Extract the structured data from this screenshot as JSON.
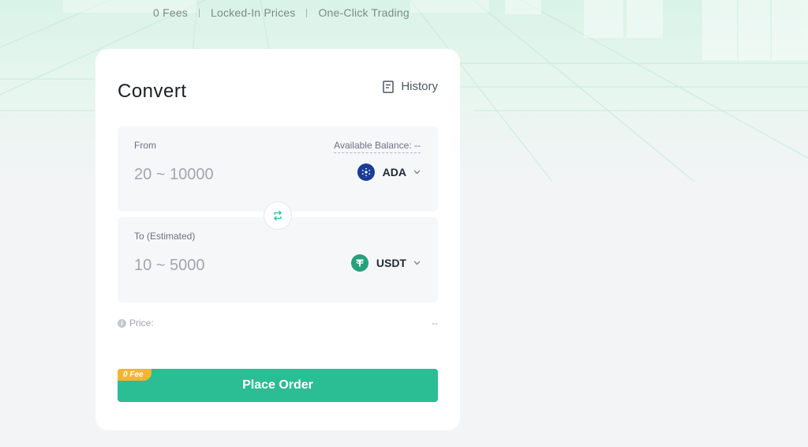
{
  "features": [
    "0 Fees",
    "Locked-In Prices",
    "One-Click Trading"
  ],
  "convert": {
    "title": "Convert",
    "history_label": "History",
    "from": {
      "label": "From",
      "balance_label": "Available Balance: --",
      "placeholder": "20 ~ 10000",
      "coin": "ADA",
      "coin_icon": "cardano-icon"
    },
    "to": {
      "label": "To (Estimated)",
      "placeholder": "10 ~ 5000",
      "coin": "USDT",
      "coin_icon": "tether-icon"
    },
    "price_label": "Price:",
    "price_value": "--",
    "fee_tag": "0 Fee",
    "order_button": "Place Order"
  },
  "colors": {
    "accent": "#2bbd93",
    "fee_tag": "#f5b52f",
    "ada": "#1b3b97",
    "usdt": "#26a17b"
  }
}
